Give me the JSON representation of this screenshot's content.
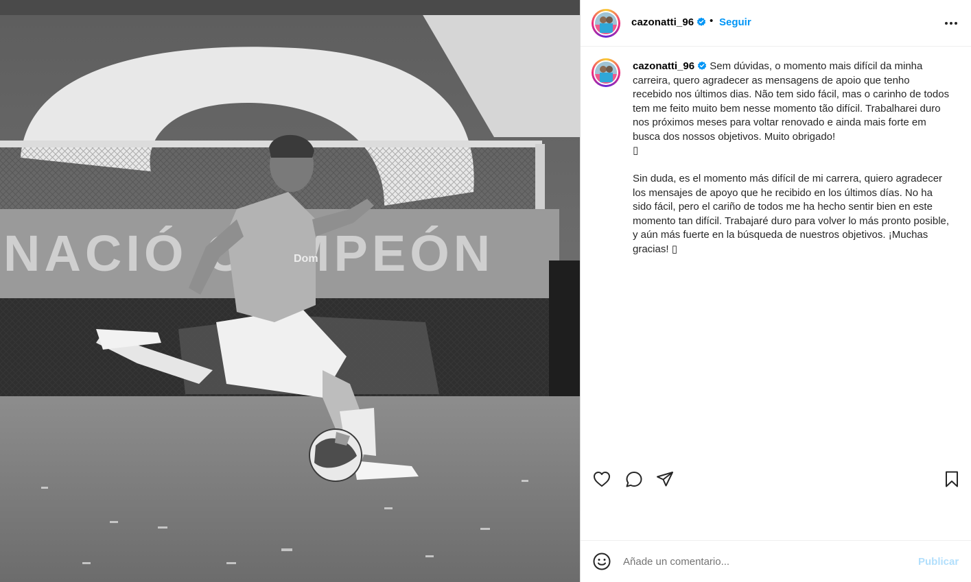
{
  "post": {
    "username": "cazonatti_96",
    "follow_label": "Seguir",
    "separator": "•",
    "caption_user": "cazonatti_96",
    "caption_pt": "Sem dúvidas, o momento mais difícil da minha carreira, quero agradecer as mensagens de apoio que tenho recebido nos últimos dias. Não tem sido fácil, mas o carinho de todos tem me feito muito bem nesse momento tão difícil. Trabalharei duro nos próximos meses para voltar renovado e ainda mais forte em busca dos nossos objetivos. Muito obrigado!\n▯",
    "caption_es": "Sin duda, es el momento más difícil de mi carrera, quiero agradecer los mensajes de apoyo que he recibido en los últimos días. No ha sido fácil, pero el cariño de todos me ha hecho sentir bien en este momento tan difícil. Trabajaré duro para volver lo más pronto posible, y aún más fuerte en la búsqueda de nuestros objetivos. ¡Muchas gracias! ▯"
  },
  "photo": {
    "banner_text": "NACIÓ CAMPEÓN",
    "shirt_text": "Dom"
  },
  "comment": {
    "placeholder": "Añade un comentario...",
    "publish_label": "Publicar"
  },
  "icons": {
    "verified": "verified-badge-icon",
    "more": "more-options-icon",
    "like": "heart-icon",
    "comment": "comment-bubble-icon",
    "share": "paper-plane-icon",
    "save": "bookmark-icon",
    "emoji": "smiley-icon"
  },
  "colors": {
    "link": "#0095f6",
    "publish_disabled": "#b2dffc",
    "verified": "#0095f6"
  }
}
